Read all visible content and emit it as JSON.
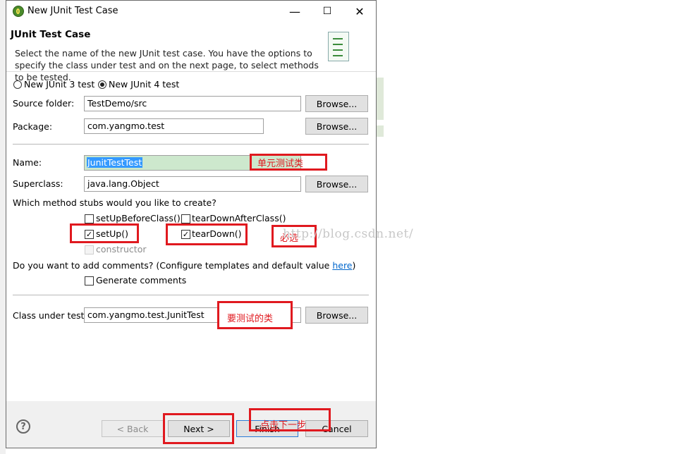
{
  "window": {
    "title": "New JUnit Test Case",
    "minimize_glyph": "—",
    "maximize_glyph": "☐",
    "close_glyph": "✕"
  },
  "banner": {
    "title": "JUnit Test Case",
    "description": "Select the name of the new JUnit test case. You have the options to specify the class under test and on the next page, to select methods to be tested."
  },
  "junit_version": {
    "options": [
      "New JUnit 3 test",
      "New JUnit 4 test"
    ],
    "selected": "New JUnit 4 test"
  },
  "source_folder": {
    "label": "Source folder:",
    "value": "TestDemo/src",
    "browse": "Browse..."
  },
  "package": {
    "label": "Package:",
    "value": "com.yangmo.test",
    "browse": "Browse..."
  },
  "name": {
    "label": "Name:",
    "value": "JunitTestTest"
  },
  "superclass": {
    "label": "Superclass:",
    "value": "java.lang.Object",
    "browse": "Browse..."
  },
  "stubs": {
    "question": "Which method stubs would you like to create?",
    "setUpBeforeClass": {
      "label": "setUpBeforeClass()",
      "checked": false
    },
    "tearDownAfterClass": {
      "label": "tearDownAfterClass()",
      "checked": false
    },
    "setUp": {
      "label": "setUp()",
      "checked": true
    },
    "tearDown": {
      "label": "tearDown()",
      "checked": true
    },
    "constructor": {
      "label": "constructor",
      "checked": false,
      "enabled": false
    }
  },
  "comments": {
    "question": "Do you want to add comments? (Configure templates and default value",
    "link": "here",
    "close_paren": ")",
    "generate": {
      "label": "Generate comments",
      "checked": false
    }
  },
  "class_under_test": {
    "label": "Class under test:",
    "value": "com.yangmo.test.JunitTest",
    "browse": "Browse..."
  },
  "annotations": {
    "unit_test_class": "单元测试类",
    "required": "必选",
    "class_to_test": "要测试的类",
    "click_next": "点击下一步"
  },
  "watermark": "http://blog.csdn.net/",
  "footer": {
    "help": "?",
    "back": "< Back",
    "next": "Next >",
    "finish": "Finish",
    "cancel": "Cancel"
  },
  "colors": {
    "annotation_red": "#e0191f",
    "name_field_bg": "#cde8cd",
    "selection_blue": "#3399ff",
    "link_blue": "#0066cc"
  }
}
